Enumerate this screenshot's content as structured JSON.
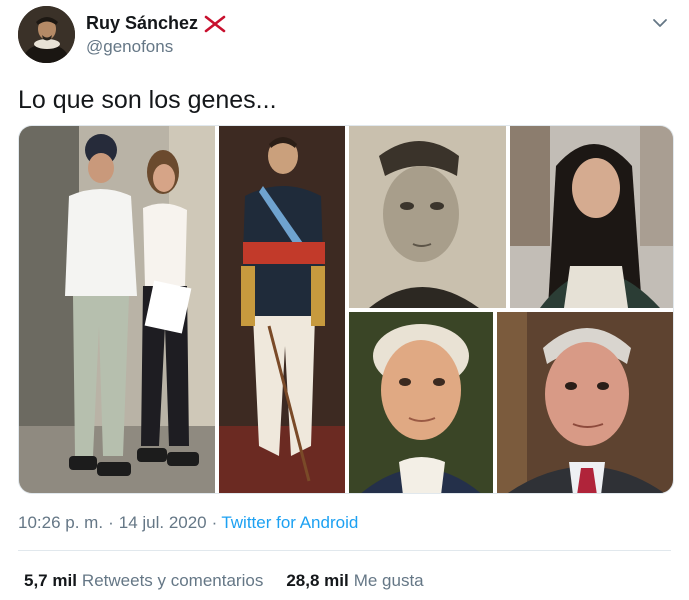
{
  "tweet": {
    "author_name": "Ruy Sánchez",
    "author_handle": "@genofons",
    "text": "Lo que son los genes...",
    "time": "10:26 p. m.",
    "separator": "·",
    "date": "14 jul. 2020",
    "source": "Twitter for Android",
    "retweets_count": "5,7 mil",
    "retweets_label": "Retweets y comentarios",
    "likes_count": "28,8 mil",
    "likes_label": "Me gusta"
  },
  "icons": {
    "flag": "saltire-flag-icon",
    "menu": "chevron-down-icon"
  },
  "colors": {
    "text_primary": "#14171a",
    "text_secondary": "#657786",
    "link": "#1da1f2",
    "divider": "#e1e8ed",
    "flag_red": "#c8102e"
  }
}
